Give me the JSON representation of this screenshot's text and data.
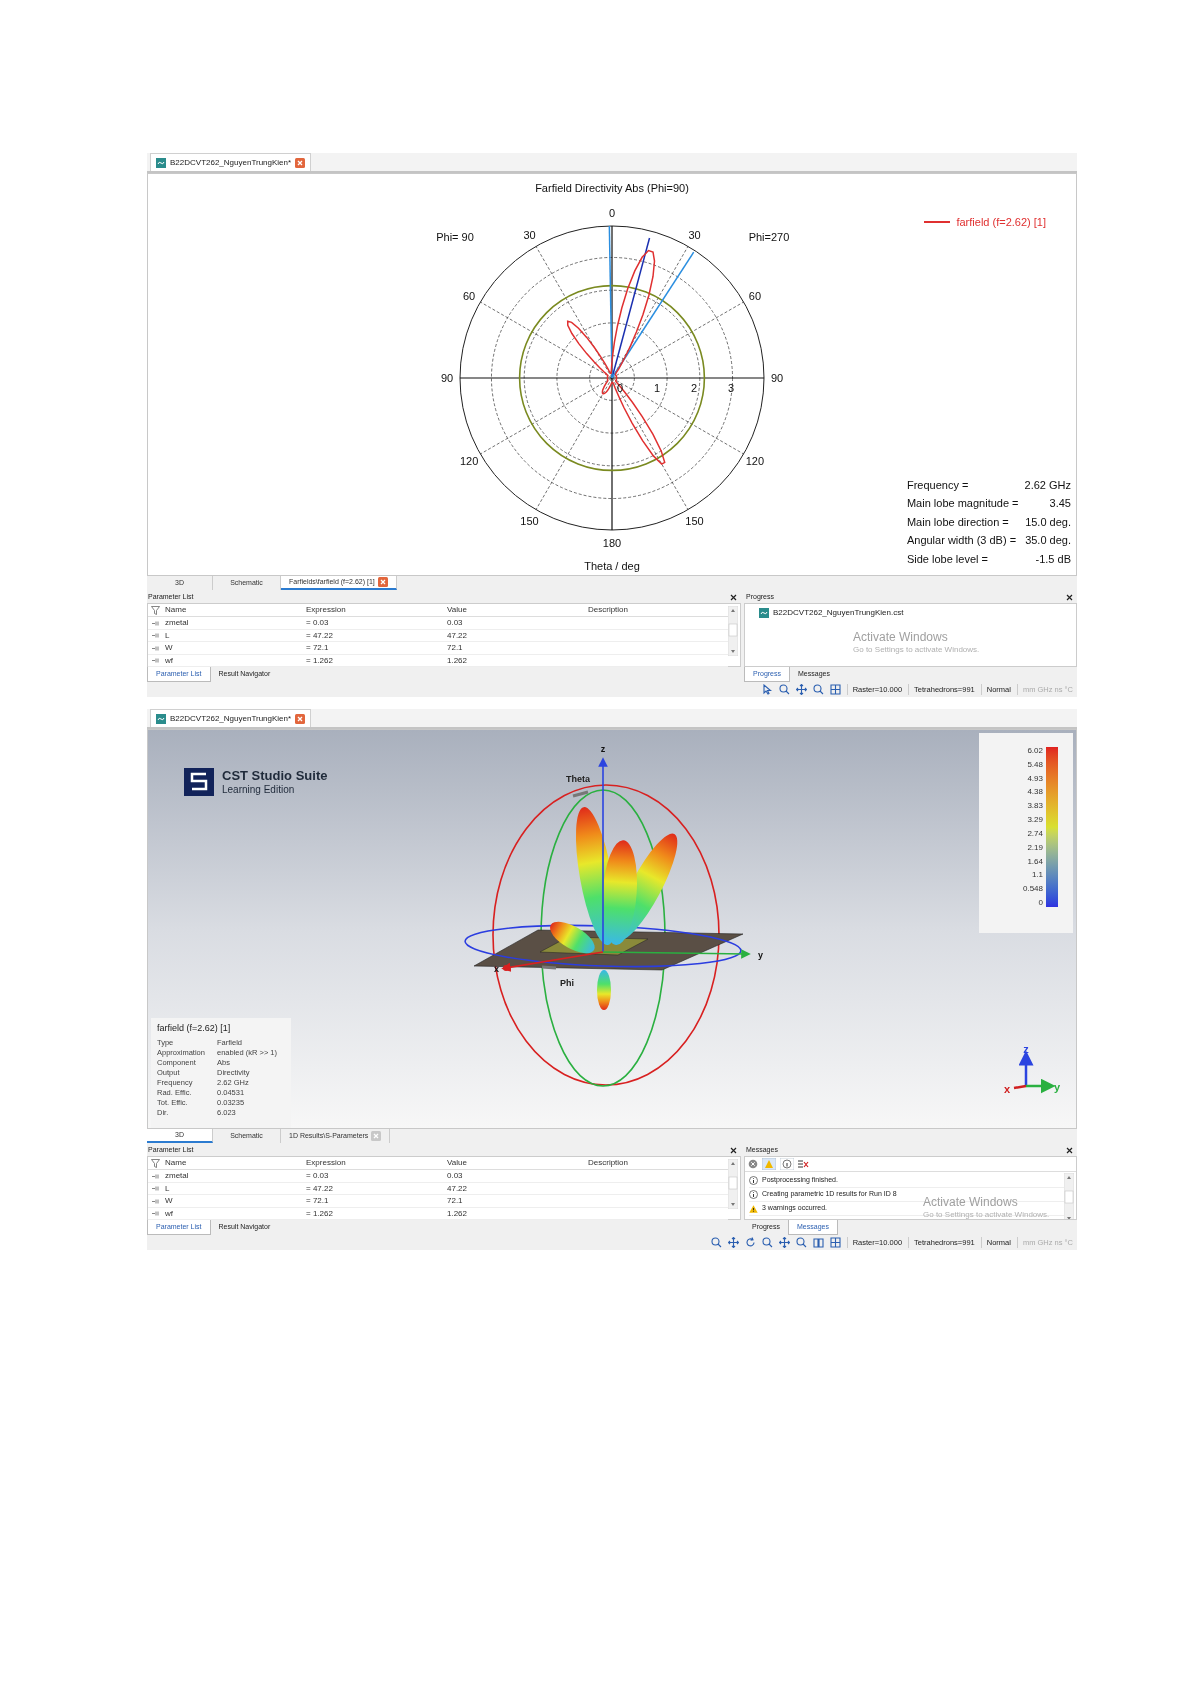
{
  "screens": [
    {
      "document_tab": {
        "label": "B22DCVT262_NguyenTrungKien*"
      },
      "main_view": {
        "kind": "polar",
        "title": "Farfield Directivity Abs (Phi=90)",
        "phi_left": "Phi= 90",
        "phi_right": "Phi=270",
        "angle_labels": [
          "0",
          "30",
          "60",
          "90",
          "120",
          "150",
          "180",
          "150",
          "120",
          "90",
          "60",
          "30"
        ],
        "radial_labels": [
          "0",
          "1",
          "2",
          "3"
        ],
        "axis_label": "Theta / deg",
        "legend": {
          "label": "farfield (f=2.62) [1]",
          "color": "#e03030"
        },
        "info": [
          {
            "label": "Frequency =",
            "value": "2.62 GHz"
          },
          {
            "label": "Main lobe magnitude =",
            "value": "3.45"
          },
          {
            "label": "Main lobe direction =",
            "value": "15.0 deg."
          },
          {
            "label": "Angular width (3 dB) =",
            "value": "35.0 deg."
          },
          {
            "label": "Side lobe level =",
            "value": "-1.5 dB"
          }
        ]
      },
      "view_tabs": [
        {
          "label": "3D",
          "selected": false,
          "closable": false
        },
        {
          "label": "Schematic",
          "selected": false,
          "closable": false
        },
        {
          "label": "Farfields\\farfield (f=2.62) [1]",
          "selected": true,
          "closable": true
        }
      ],
      "parameter_panel": {
        "title": "Parameter List",
        "columns": [
          "Name",
          "Expression",
          "Value",
          "Description"
        ],
        "rows": [
          {
            "name": "zmetal",
            "expression": "= 0.03",
            "value": "0.03"
          },
          {
            "name": "L",
            "expression": "= 47.22",
            "value": "47.22"
          },
          {
            "name": "W",
            "expression": "= 72.1",
            "value": "72.1"
          },
          {
            "name": "wf",
            "expression": "= 1.262",
            "value": "1.262"
          }
        ],
        "tabs": [
          {
            "label": "Parameter List",
            "selected": true
          },
          {
            "label": "Result Navigator",
            "selected": false
          }
        ]
      },
      "right_panel": {
        "kind": "progress",
        "title": "Progress",
        "file": "B22DCVT262_NguyenTrungKien.cst",
        "tabs": [
          {
            "label": "Progress",
            "selected": true
          },
          {
            "label": "Messages",
            "selected": false
          }
        ]
      },
      "os_notice": [
        "Activate Windows",
        "Go to Settings to activate Windows."
      ],
      "status_bar": {
        "kind": "plot",
        "items": [
          "Raster=10.000",
          "Tetrahedrons=991",
          "Normal"
        ],
        "units": "mm GHz ns °C"
      }
    },
    {
      "document_tab": {
        "label": "B22DCVT262_NguyenTrungKien*"
      },
      "main_view": {
        "kind": "perspective",
        "logo_title": "CST Studio Suite",
        "logo_subtitle": "Learning Edition",
        "axis_labels": {
          "z": "z",
          "y": "y",
          "x": "x",
          "theta": "Theta",
          "phi": "Phi"
        },
        "colorbar_ticks": [
          "6.02",
          "5.48",
          "4.93",
          "4.38",
          "3.83",
          "3.29",
          "2.74",
          "2.19",
          "1.64",
          "1.1",
          "0.548",
          "0"
        ],
        "info_title": "farfield (f=2.62) [1]",
        "info": [
          {
            "label": "Type",
            "value": "Farfield"
          },
          {
            "label": "Approximation",
            "value": "enabled (kR >> 1)"
          },
          {
            "label": "Component",
            "value": "Abs"
          },
          {
            "label": "Output",
            "value": "Directivity"
          },
          {
            "label": "Frequency",
            "value": "2.62 GHz"
          },
          {
            "label": "Rad. Effic.",
            "value": "0.04531"
          },
          {
            "label": "Tot. Effic.",
            "value": "0.03235"
          },
          {
            "label": "Dir.",
            "value": "6.023"
          }
        ],
        "triad": {
          "z": "z",
          "x": "x",
          "y": "y"
        }
      },
      "view_tabs": [
        {
          "label": "3D",
          "selected": true,
          "closable": false
        },
        {
          "label": "Schematic",
          "selected": false,
          "closable": false
        },
        {
          "label": "1D Results\\S-Parameters",
          "selected": false,
          "closable": true
        }
      ],
      "parameter_panel": {
        "title": "Parameter List",
        "columns": [
          "Name",
          "Expression",
          "Value",
          "Description"
        ],
        "rows": [
          {
            "name": "zmetal",
            "expression": "= 0.03",
            "value": "0.03"
          },
          {
            "name": "L",
            "expression": "= 47.22",
            "value": "47.22"
          },
          {
            "name": "W",
            "expression": "= 72.1",
            "value": "72.1"
          },
          {
            "name": "wf",
            "expression": "= 1.262",
            "value": "1.262"
          }
        ],
        "tabs": [
          {
            "label": "Parameter List",
            "selected": true
          },
          {
            "label": "Result Navigator",
            "selected": false
          }
        ]
      },
      "right_panel": {
        "kind": "messages",
        "title": "Messages",
        "messages": [
          {
            "kind": "info",
            "text": "Postprocessing finished."
          },
          {
            "kind": "info",
            "text": "Creating parametric 1D results for Run ID 8"
          },
          {
            "kind": "warning",
            "text": "3 warnings occurred."
          }
        ],
        "tabs": [
          {
            "label": "Progress",
            "selected": false
          },
          {
            "label": "Messages",
            "selected": true
          }
        ]
      },
      "os_notice": [
        "Activate Windows",
        "Go to Settings to activate Windows."
      ],
      "status_bar": {
        "kind": "model",
        "items": [
          "Raster=10.000",
          "Tetrahedrons=991",
          "Normal"
        ],
        "units": "mm GHz ns °C"
      }
    }
  ]
}
